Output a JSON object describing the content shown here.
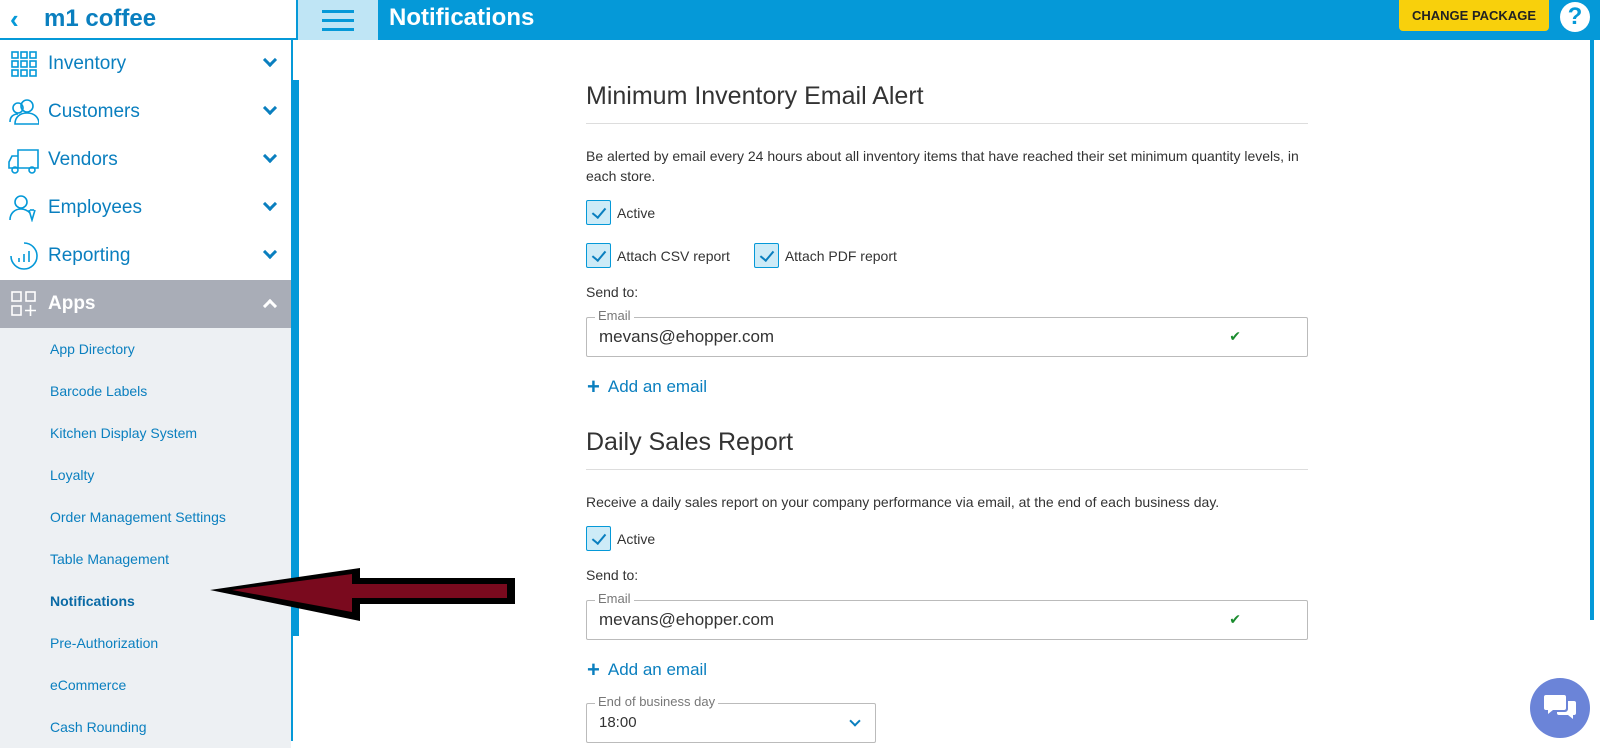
{
  "header": {
    "brand": "m1 coffee",
    "title": "Notifications",
    "change_package": "CHANGE PACKAGE",
    "help": "?"
  },
  "sidebar": {
    "items": [
      {
        "label": "Inventory",
        "icon": "grid-icon"
      },
      {
        "label": "Customers",
        "icon": "customers-icon"
      },
      {
        "label": "Vendors",
        "icon": "truck-icon"
      },
      {
        "label": "Employees",
        "icon": "employees-icon"
      },
      {
        "label": "Reporting",
        "icon": "chart-icon"
      },
      {
        "label": "Apps",
        "icon": "apps-icon"
      }
    ],
    "sub_items": [
      "App Directory",
      "Barcode Labels",
      "Kitchen Display System",
      "Loyalty",
      "Order Management Settings",
      "Table Management",
      "Notifications",
      "Pre-Authorization",
      "eCommerce",
      "Cash Rounding"
    ]
  },
  "min_inventory": {
    "title": "Minimum Inventory Email Alert",
    "description": "Be alerted by email every 24 hours about all inventory items that have reached their set minimum quantity levels, in each store.",
    "active_label": "Active",
    "csv_label": "Attach CSV report",
    "pdf_label": "Attach PDF report",
    "send_to": "Send to:",
    "email_legend": "Email",
    "email_value": "mevans@ehopper.com",
    "add_email": "Add an email"
  },
  "daily_sales": {
    "title": "Daily Sales Report",
    "description": "Receive a daily sales report on your company performance via email, at the end of each business day.",
    "active_label": "Active",
    "send_to": "Send to:",
    "email_legend": "Email",
    "email_value": "mevans@ehopper.com",
    "add_email": "Add an email",
    "eod_legend": "End of business day",
    "eod_value": "18:00"
  },
  "colors": {
    "primary": "#0599d8",
    "accent": "#f8d00c",
    "annotation_arrow": "#7a0a1e"
  }
}
